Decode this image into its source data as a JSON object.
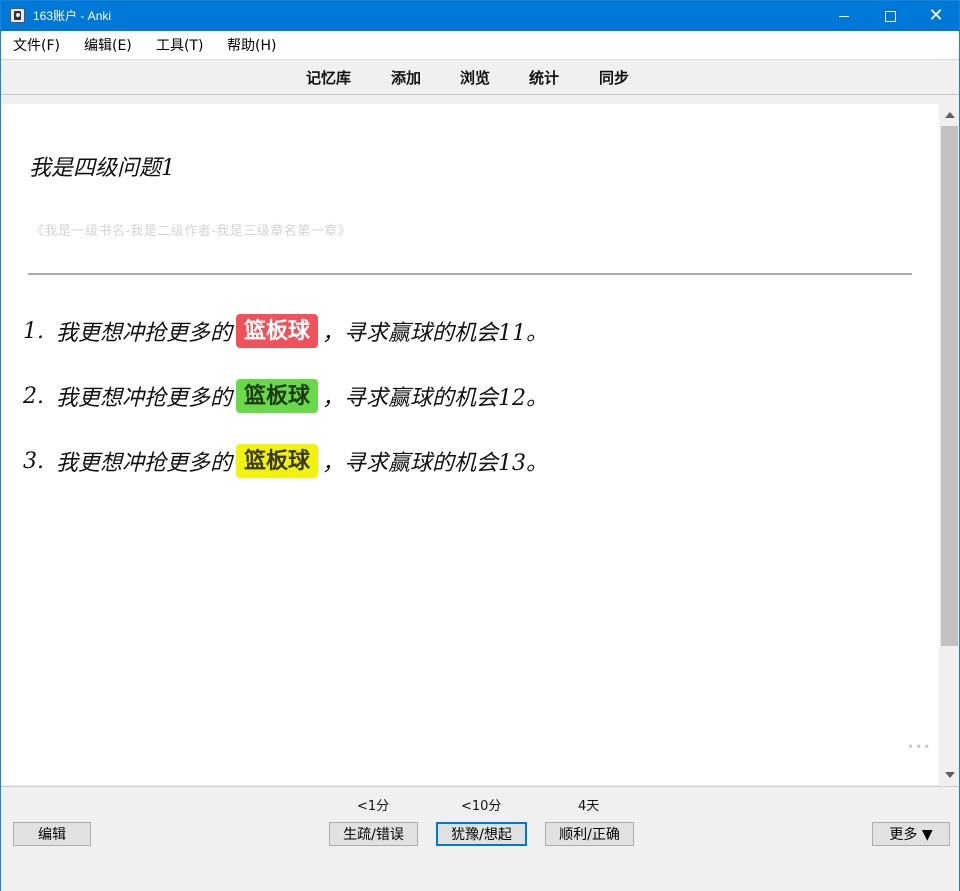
{
  "window": {
    "title": "163账户 - Anki"
  },
  "menu": [
    "文件(F)",
    "编辑(E)",
    "工具(T)",
    "帮助(H)"
  ],
  "toolbar": [
    "记忆库",
    "添加",
    "浏览",
    "统计",
    "同步"
  ],
  "card": {
    "question": "我是四级问题1",
    "source": "《我是一级书名-我是二级作者-我是三级章名第一章》",
    "answers": [
      {
        "num": "1.",
        "before": "我更想冲抢更多的",
        "keyword": "篮板球",
        "after": "，寻求赢球的机会11。",
        "color": "#f0525b"
      },
      {
        "num": "2.",
        "before": "我更想冲抢更多的",
        "keyword": "篮板球",
        "after": "，寻求赢球的机会12。",
        "color": "#69d94a"
      },
      {
        "num": "3.",
        "before": "我更想冲抢更多的",
        "keyword": "篮板球",
        "after": "，寻求赢球的机会13。",
        "color": "#f2f20f"
      }
    ]
  },
  "bottom": {
    "edit_label": "编辑",
    "intervals": [
      "<1分",
      "<10分",
      "4天"
    ],
    "answer_buttons": [
      "生疏/错误",
      "犹豫/想起",
      "顺利/正确"
    ],
    "more_label": "更多 ▼"
  }
}
